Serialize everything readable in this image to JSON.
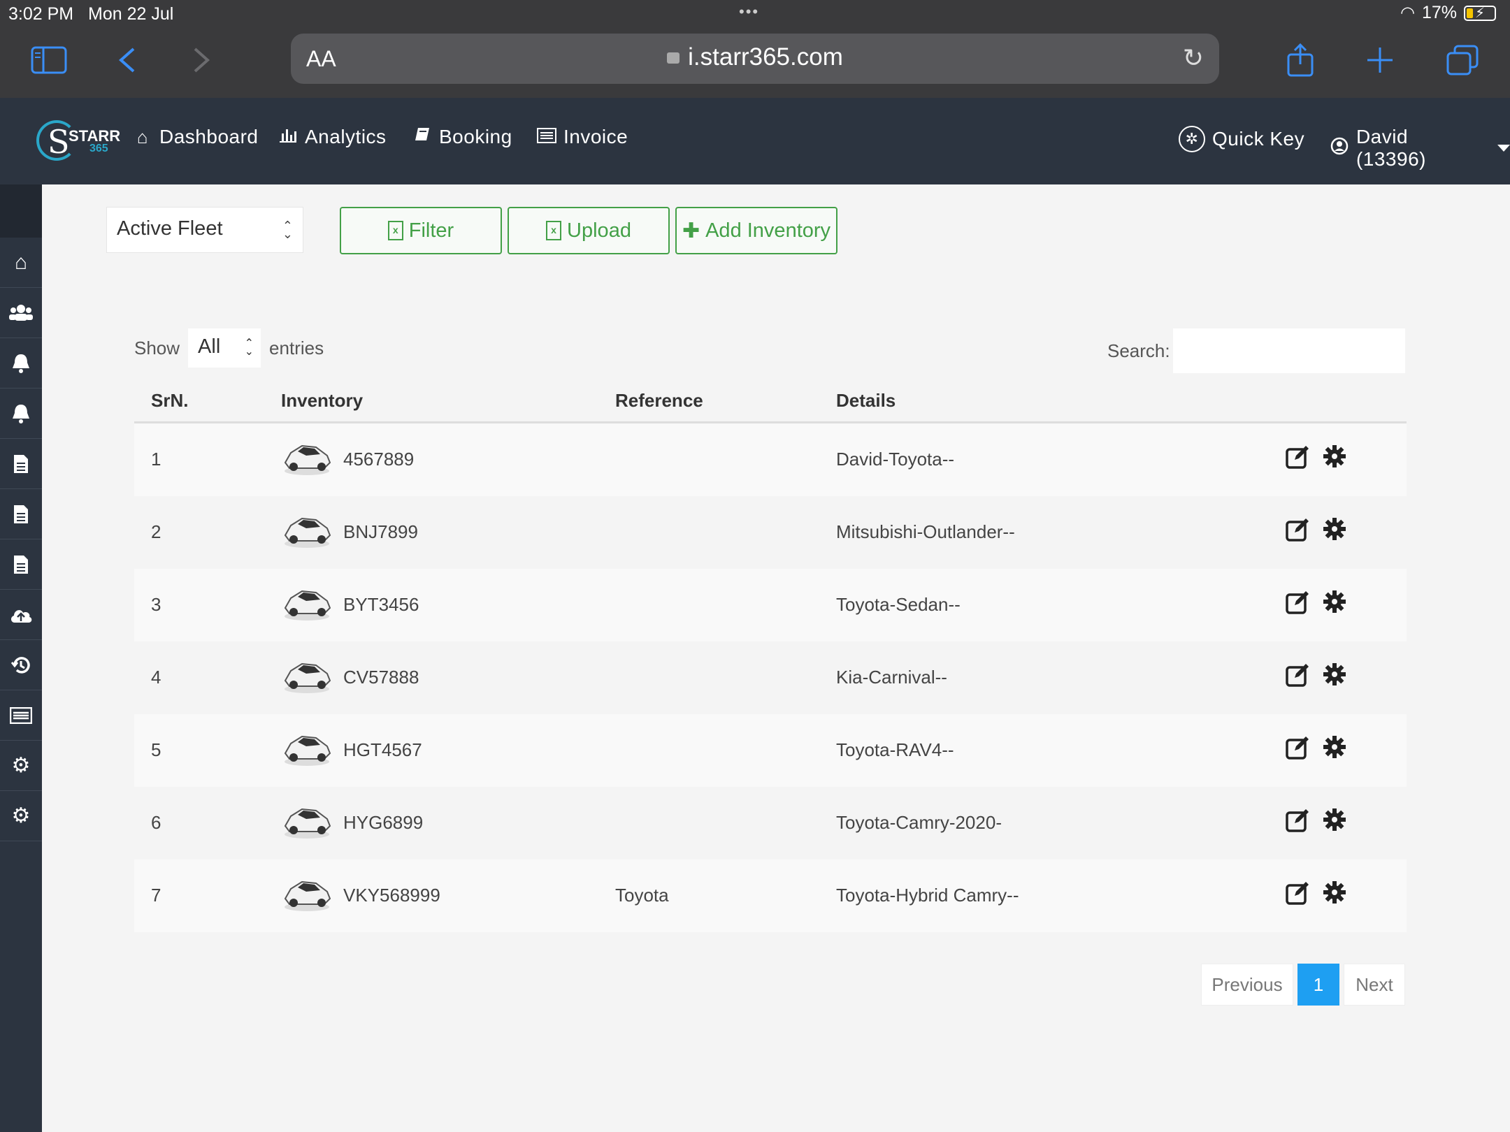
{
  "status_bar": {
    "time": "3:02 PM",
    "date": "Mon 22 Jul",
    "battery": "17%"
  },
  "browser": {
    "url": "i.starr365.com",
    "text_size": "AA"
  },
  "app": {
    "logo_text": "STARR",
    "logo_sub": "365",
    "nav": [
      {
        "label": "Dashboard",
        "icon": "home-icon"
      },
      {
        "label": "Analytics",
        "icon": "bar-chart-icon"
      },
      {
        "label": "Booking",
        "icon": "book-icon"
      },
      {
        "label": "Invoice",
        "icon": "list-icon"
      }
    ],
    "quick_key": "Quick Key",
    "user": "David (13396)"
  },
  "sidebar": {
    "items": [
      "home-icon",
      "users-icon",
      "bell-icon",
      "bell-icon",
      "document-icon",
      "document-icon",
      "document-icon",
      "cloud-upload-icon",
      "history-icon",
      "list-icon",
      "gear-icon",
      "gear-icon"
    ]
  },
  "toolbar": {
    "fleet_select": "Active Fleet",
    "filter_label": "Filter",
    "upload_label": "Upload",
    "add_label": "Add Inventory",
    "accent": "#43a047"
  },
  "table_controls": {
    "show_label": "Show",
    "show_value": "All",
    "entries_label": "entries",
    "search_label": "Search:"
  },
  "table": {
    "headers": [
      "SrN.",
      "Inventory",
      "Reference",
      "Details"
    ],
    "rows": [
      {
        "sr": "1",
        "inventory": "4567889",
        "reference": "",
        "details": "David-Toyota--"
      },
      {
        "sr": "2",
        "inventory": "BNJ7899",
        "reference": "",
        "details": "Mitsubishi-Outlander--"
      },
      {
        "sr": "3",
        "inventory": "BYT3456",
        "reference": "",
        "details": "Toyota-Sedan--"
      },
      {
        "sr": "4",
        "inventory": "CV57888",
        "reference": "",
        "details": "Kia-Carnival--"
      },
      {
        "sr": "5",
        "inventory": "HGT4567",
        "reference": "",
        "details": "Toyota-RAV4--"
      },
      {
        "sr": "6",
        "inventory": "HYG6899",
        "reference": "",
        "details": "Toyota-Camry-2020-"
      },
      {
        "sr": "7",
        "inventory": "VKY568999",
        "reference": "Toyota",
        "details": "Toyota-Hybrid Camry--"
      }
    ]
  },
  "pagination": {
    "previous": "Previous",
    "current": "1",
    "next": "Next",
    "active_color": "#1e9ff2"
  }
}
